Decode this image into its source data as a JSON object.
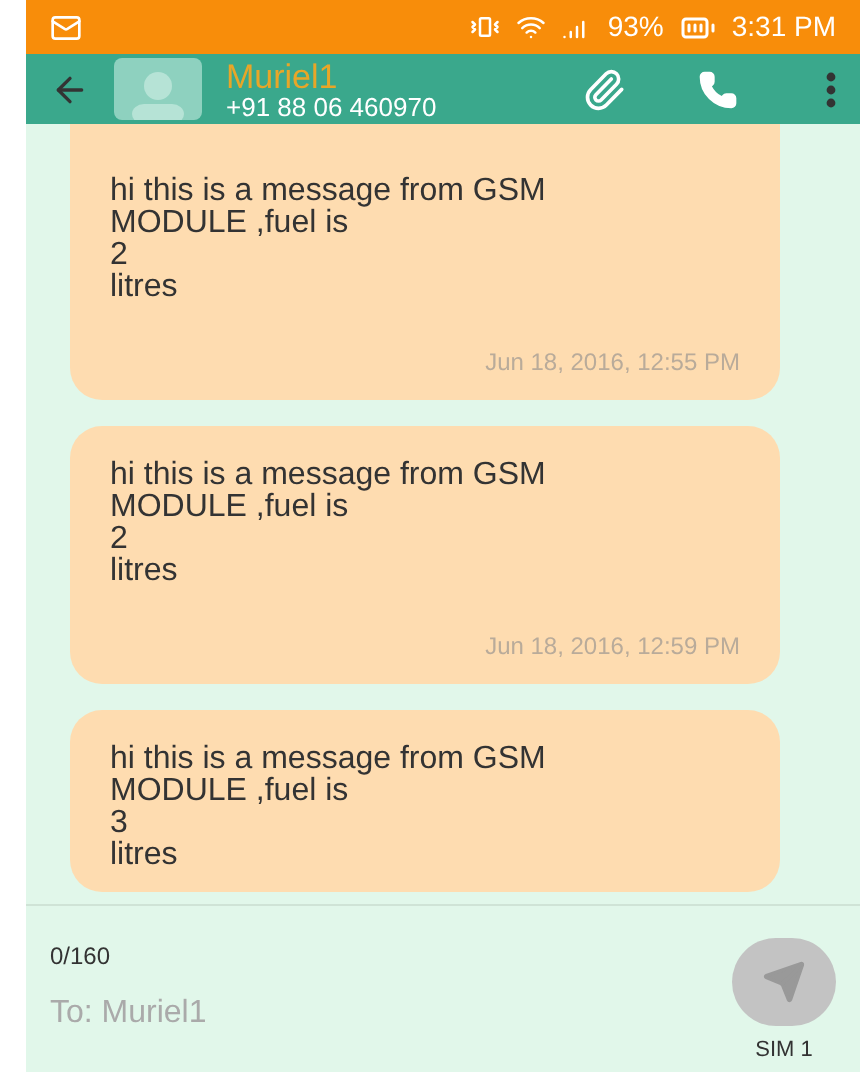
{
  "status_bar": {
    "battery": "93%",
    "time": "3:31 PM"
  },
  "header": {
    "name": "Muriel1",
    "number": "+91 88 06 460970"
  },
  "messages": [
    {
      "lines": [
        "hi this is a message from GSM",
        "MODULE ,fuel is",
        "2",
        "litres"
      ],
      "time": "Jun 18, 2016, 12:55 PM"
    },
    {
      "lines": [
        "hi this is a message from GSM",
        "MODULE ,fuel is",
        "2",
        "litres"
      ],
      "time": "Jun 18, 2016, 12:59 PM"
    },
    {
      "lines": [
        "hi this is a message from GSM",
        "MODULE ,fuel is",
        "3",
        "litres"
      ]
    }
  ],
  "composer": {
    "counter": "0/160",
    "placeholder": "To: Muriel1",
    "sim": "SIM 1"
  }
}
